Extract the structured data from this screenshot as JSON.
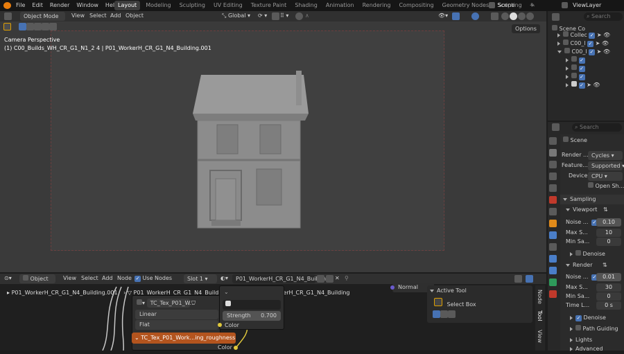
{
  "topbar": {
    "menus": [
      "File",
      "Edit",
      "Render",
      "Window",
      "Help"
    ],
    "workspaces": [
      "Layout",
      "Modeling",
      "Sculpting",
      "UV Editing",
      "Texture Paint",
      "Shading",
      "Animation",
      "Rendering",
      "Compositing",
      "Geometry Nodes",
      "Scripting"
    ],
    "active_workspace": "Layout",
    "add_tab": "+",
    "scene": "Scene",
    "view_layer": "ViewLayer"
  },
  "viewport": {
    "mode": "Object Mode",
    "menus": [
      "View",
      "Select",
      "Add",
      "Object"
    ],
    "orientation": "Global",
    "options": "Options",
    "overlay_title": "Camera Perspective",
    "overlay_sub": "(1) C00_Builds_WH_CR_G1_N1_2 4 | P01_WorkerH_CR_G1_N4_Building.001"
  },
  "outliner": {
    "search": "Search",
    "root": "Scene Co",
    "items": [
      "Collec",
      "C00_l",
      "C00_l"
    ]
  },
  "properties": {
    "search": "Search",
    "scene": "Scene",
    "render_engine_label": "Render ...",
    "render_engine": "Cycles",
    "feature_label": "Feature...",
    "feature": "Supported",
    "device_label": "Device",
    "device": "CPU",
    "open_shading": "Open Sh...",
    "sampling": "Sampling",
    "viewport": "Viewport",
    "noise_label": "Noise ...",
    "noise_val": "0.10",
    "max_label": "Max S...",
    "max_val": "10",
    "min_label": "Min Sa...",
    "min_val": "0",
    "denoise": "Denoise",
    "render": "Render",
    "noise2_val": "0.01",
    "max2_val": "30",
    "min2_val": "0",
    "time_label": "Time L...",
    "time_val": "0 s",
    "denoise2": "Denoise",
    "path_guiding": "Path Guiding",
    "lights": "Lights",
    "advanced": "Advanced"
  },
  "node_editor": {
    "type": "Object",
    "menus": [
      "View",
      "Select",
      "Add",
      "Node"
    ],
    "use_nodes": "Use Nodes",
    "slot": "Slot 1",
    "material": "P01_WorkerH_CR_G1_N4_Building",
    "breadcrumb1": "P01_WorkerH_CR_G1_N4_Building.002",
    "breadcrumb2": "P01_WorkerH_CR_G1_N4_Building",
    "breadcrumb0": "P01_WorkerH_CR_G1_N4_Building.001",
    "tex_name": "TC_Tex_P01_W...",
    "interp": "Linear",
    "proj": "Flat",
    "strength_label": "Strength",
    "strength_val": "0.700",
    "color_label": "Color",
    "color_out": "Color",
    "normal": "Normal",
    "tex2": "TC_Tex_P01_Work...ing_roughness.png",
    "active_tool": "Active Tool",
    "select_box": "Select Box",
    "side_tabs": [
      "Node",
      "Tool",
      "View"
    ]
  }
}
